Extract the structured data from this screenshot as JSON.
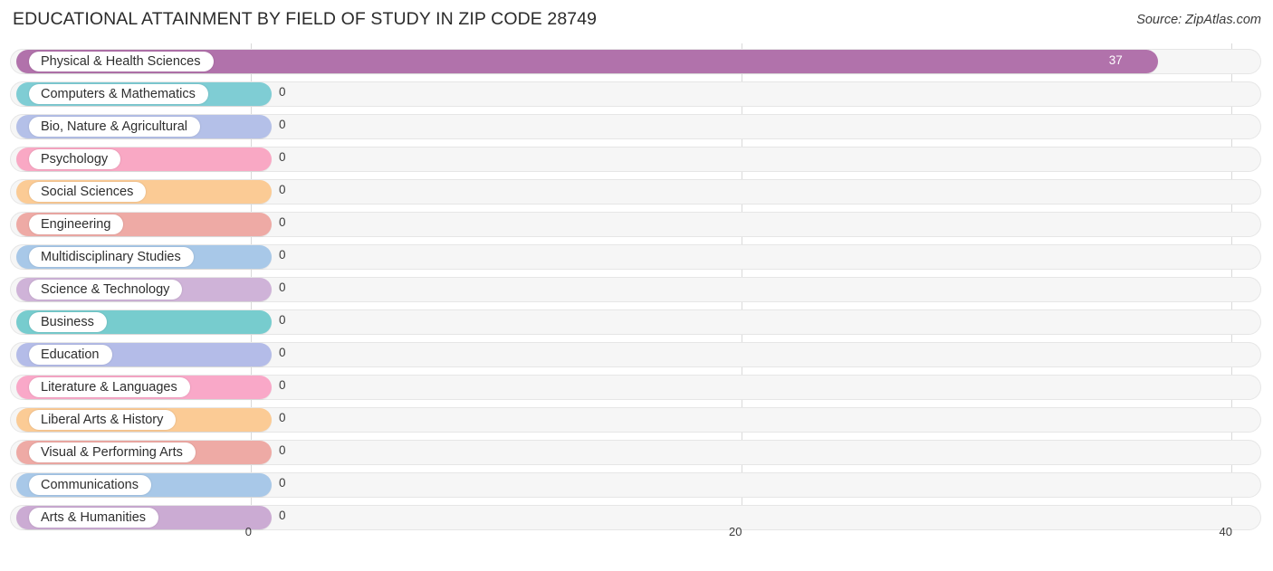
{
  "header": {
    "title": "EDUCATIONAL ATTAINMENT BY FIELD OF STUDY IN ZIP CODE 28749",
    "source": "Source: ZipAtlas.com"
  },
  "chart_data": {
    "type": "bar",
    "orientation": "horizontal",
    "title": "EDUCATIONAL ATTAINMENT BY FIELD OF STUDY IN ZIP CODE 28749",
    "xlabel": "",
    "ylabel": "",
    "xlim": [
      0,
      40
    ],
    "xticks": [
      0,
      20,
      40
    ],
    "xtick_labels": [
      "0",
      "20",
      "40"
    ],
    "grid": true,
    "legend": "none",
    "categories": [
      "Physical & Health Sciences",
      "Computers & Mathematics",
      "Bio, Nature & Agricultural",
      "Psychology",
      "Social Sciences",
      "Engineering",
      "Multidisciplinary Studies",
      "Science & Technology",
      "Business",
      "Education",
      "Literature & Languages",
      "Liberal Arts & History",
      "Visual & Performing Arts",
      "Communications",
      "Arts & Humanities"
    ],
    "values": [
      37,
      0,
      0,
      0,
      0,
      0,
      0,
      0,
      0,
      0,
      0,
      0,
      0,
      0,
      0
    ],
    "value_labels": [
      "37",
      "0",
      "0",
      "0",
      "0",
      "0",
      "0",
      "0",
      "0",
      "0",
      "0",
      "0",
      "0",
      "0",
      "0"
    ],
    "colors": [
      "#b172ab",
      "#7fcdd4",
      "#b4c0e8",
      "#f9a8c4",
      "#fbcb95",
      "#eeaaa5",
      "#a8c8e8",
      "#cfb3d8",
      "#77ccce",
      "#b4bce8",
      "#f9a8c8",
      "#fbcb95",
      "#eeaaa5",
      "#a8c8e8",
      "#cbabd3"
    ]
  },
  "style": {
    "track_color": "#f6f6f6",
    "gridline_color": "#d9d9d9",
    "background": "#ffffff"
  }
}
